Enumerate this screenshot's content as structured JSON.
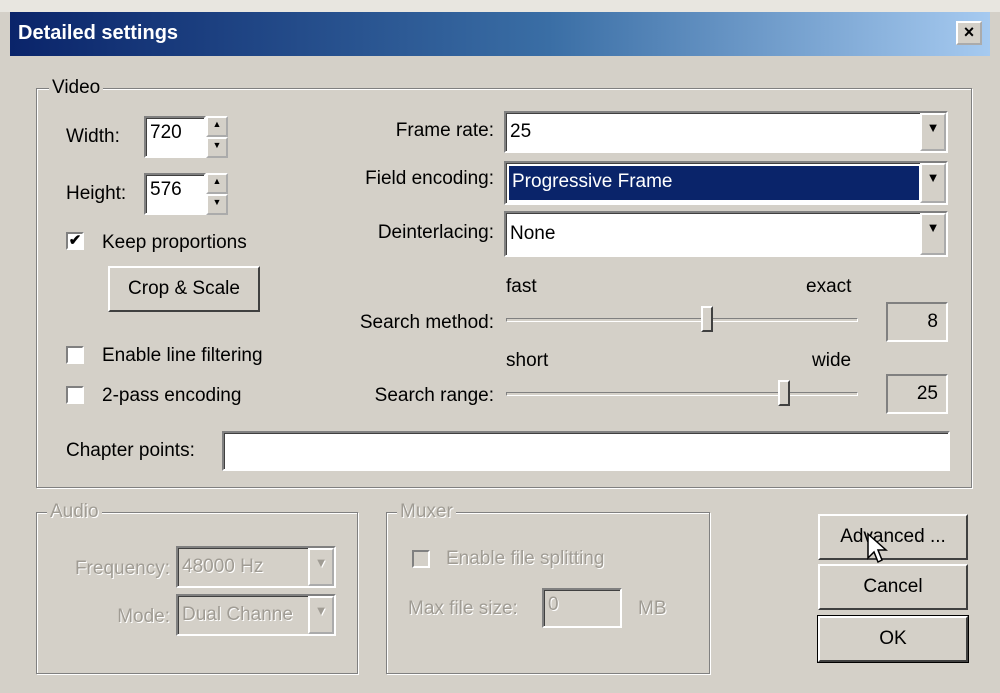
{
  "window": {
    "title": "Detailed settings",
    "close_glyph": "×"
  },
  "video": {
    "group_label": "Video",
    "width": {
      "label": "Width:",
      "value": "720"
    },
    "height": {
      "label": "Height:",
      "value": "576"
    },
    "keep_proportions": {
      "label": "Keep proportions",
      "checked": true,
      "mark": "✔"
    },
    "crop_scale_button": "Crop & Scale",
    "enable_line_filtering": {
      "label": "Enable line filtering",
      "checked": false
    },
    "two_pass_encoding": {
      "label": "2-pass encoding",
      "checked": false
    },
    "frame_rate": {
      "label": "Frame rate:",
      "value": "25"
    },
    "field_encoding": {
      "label": "Field encoding:",
      "value": "Progressive Frame"
    },
    "deinterlacing": {
      "label": "Deinterlacing:",
      "value": "None"
    },
    "search_method": {
      "label": "Search method:",
      "min_label": "fast",
      "max_label": "exact",
      "value": "8",
      "slider_fraction": 0.57
    },
    "search_range": {
      "label": "Search range:",
      "min_label": "short",
      "max_label": "wide",
      "value": "25",
      "slider_fraction": 0.79
    },
    "chapter_points": {
      "label": "Chapter points:",
      "value": ""
    }
  },
  "audio": {
    "group_label": "Audio",
    "frequency": {
      "label": "Frequency:",
      "value": "48000 Hz"
    },
    "mode": {
      "label": "Mode:",
      "value": "Dual Channe"
    }
  },
  "muxer": {
    "group_label": "Muxer",
    "enable_file_splitting": {
      "label": "Enable file splitting",
      "checked": false
    },
    "max_file_size": {
      "label": "Max file size:",
      "value": "0",
      "unit": "MB"
    }
  },
  "buttons": {
    "advanced": "Advanced ...",
    "cancel": "Cancel",
    "ok": "OK"
  },
  "icons": {
    "spin_up": "▲",
    "spin_down": "▼",
    "dropdown": "▼"
  },
  "colors": {
    "title_start": "#0a246a",
    "title_end": "#a6caf0",
    "face": "#d4d0c8",
    "selection": "#0a246a"
  }
}
